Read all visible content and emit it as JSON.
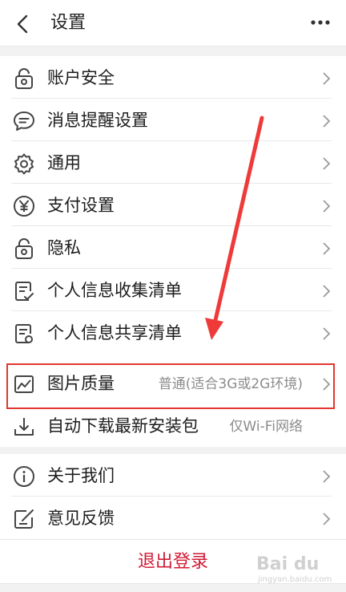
{
  "header": {
    "title": "设置"
  },
  "groups": [
    {
      "items": [
        {
          "label": "账户安全",
          "icon": "lock-icon"
        },
        {
          "label": "消息提醒设置",
          "icon": "message-icon"
        },
        {
          "label": "通用",
          "icon": "gear-icon"
        },
        {
          "label": "支付设置",
          "icon": "yen-icon"
        },
        {
          "label": "隐私",
          "icon": "lock-icon"
        },
        {
          "label": "个人信息收集清单",
          "icon": "checklist-icon"
        },
        {
          "label": "个人信息共享清单",
          "icon": "share-list-icon"
        }
      ]
    },
    {
      "items": [
        {
          "label": "图片质量",
          "value": "普通(适合3G或2G环境)",
          "icon": "image-icon"
        },
        {
          "label": "自动下载最新安装包",
          "value": "仅Wi-Fi网络",
          "icon": "download-icon"
        }
      ]
    },
    {
      "items": [
        {
          "label": "关于我们",
          "icon": "info-icon"
        },
        {
          "label": "意见反馈",
          "icon": "feedback-icon"
        }
      ]
    }
  ],
  "logout": {
    "label": "退出登录"
  },
  "watermark": {
    "main": "Bai du",
    "sub": "jingyan.baidu.com"
  },
  "colors": {
    "highlight": "#e3372f",
    "annotation_arrow": "#ef3a3a",
    "logout_text": "#d01b35"
  }
}
